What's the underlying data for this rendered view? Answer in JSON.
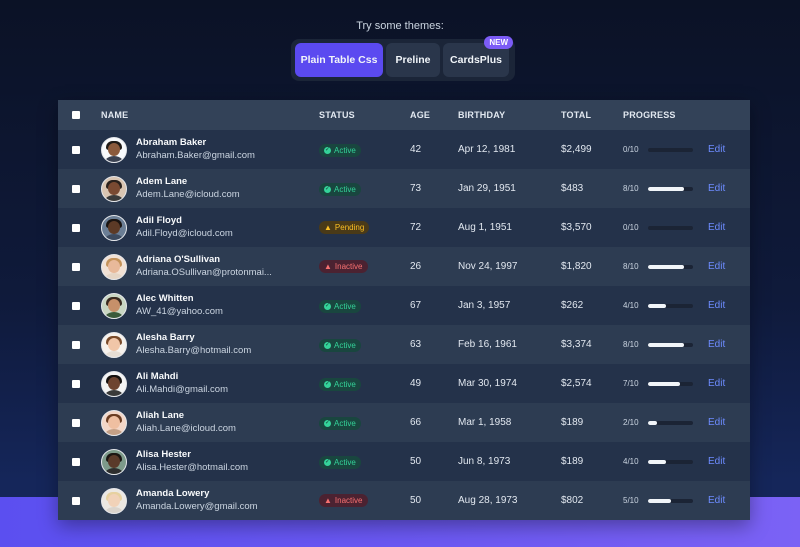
{
  "themes": {
    "label": "Try some themes:",
    "buttons": [
      {
        "label": "Plain Table Css",
        "active": true
      },
      {
        "label": "Preline",
        "active": false
      },
      {
        "label": "CardsPlus",
        "active": false,
        "badge": "NEW"
      }
    ]
  },
  "table": {
    "headers": [
      "NAME",
      "STATUS",
      "AGE",
      "BIRTHDAY",
      "TOTAL",
      "PROGRESS"
    ],
    "edit_label": "Edit",
    "rows": [
      {
        "name": "Abraham Baker",
        "email": "Abraham.Baker@gmail.com",
        "status": "Active",
        "age": "42",
        "birthday": "Apr 12, 1981",
        "total": "$2,499",
        "progress": "0/10",
        "progress_value": 0
      },
      {
        "name": "Adem Lane",
        "email": "Adem.Lane@icloud.com",
        "status": "Active",
        "age": "73",
        "birthday": "Jan 29, 1951",
        "total": "$483",
        "progress": "8/10",
        "progress_value": 0.8
      },
      {
        "name": "Adil Floyd",
        "email": "Adil.Floyd@icloud.com",
        "status": "Pending",
        "age": "72",
        "birthday": "Aug 1, 1951",
        "total": "$3,570",
        "progress": "0/10",
        "progress_value": 0
      },
      {
        "name": "Adriana O'Sullivan",
        "email": "Adriana.OSullivan@protonmai...",
        "status": "Inactive",
        "age": "26",
        "birthday": "Nov 24, 1997",
        "total": "$1,820",
        "progress": "8/10",
        "progress_value": 0.8
      },
      {
        "name": "Alec Whitten",
        "email": "AW_41@yahoo.com",
        "status": "Active",
        "age": "67",
        "birthday": "Jan 3, 1957",
        "total": "$262",
        "progress": "4/10",
        "progress_value": 0.4
      },
      {
        "name": "Alesha Barry",
        "email": "Alesha.Barry@hotmail.com",
        "status": "Active",
        "age": "63",
        "birthday": "Feb 16, 1961",
        "total": "$3,374",
        "progress": "8/10",
        "progress_value": 0.8
      },
      {
        "name": "Ali Mahdi",
        "email": "Ali.Mahdi@gmail.com",
        "status": "Active",
        "age": "49",
        "birthday": "Mar 30, 1974",
        "total": "$2,574",
        "progress": "7/10",
        "progress_value": 0.7
      },
      {
        "name": "Aliah Lane",
        "email": "Aliah.Lane@icloud.com",
        "status": "Active",
        "age": "66",
        "birthday": "Mar 1, 1958",
        "total": "$189",
        "progress": "2/10",
        "progress_value": 0.2
      },
      {
        "name": "Alisa Hester",
        "email": "Alisa.Hester@hotmail.com",
        "status": "Active",
        "age": "50",
        "birthday": "Jun 8, 1973",
        "total": "$189",
        "progress": "4/10",
        "progress_value": 0.4
      },
      {
        "name": "Amanda Lowery",
        "email": "Amanda.Lowery@gmail.com",
        "status": "Inactive",
        "age": "50",
        "birthday": "Aug 28, 1973",
        "total": "$802",
        "progress": "5/10",
        "progress_value": 0.5
      }
    ]
  },
  "colors": {
    "accent": "#5b4af0",
    "active": "#34d399",
    "pending": "#fbbf24",
    "inactive": "#f87171",
    "link": "#6d8cff"
  }
}
